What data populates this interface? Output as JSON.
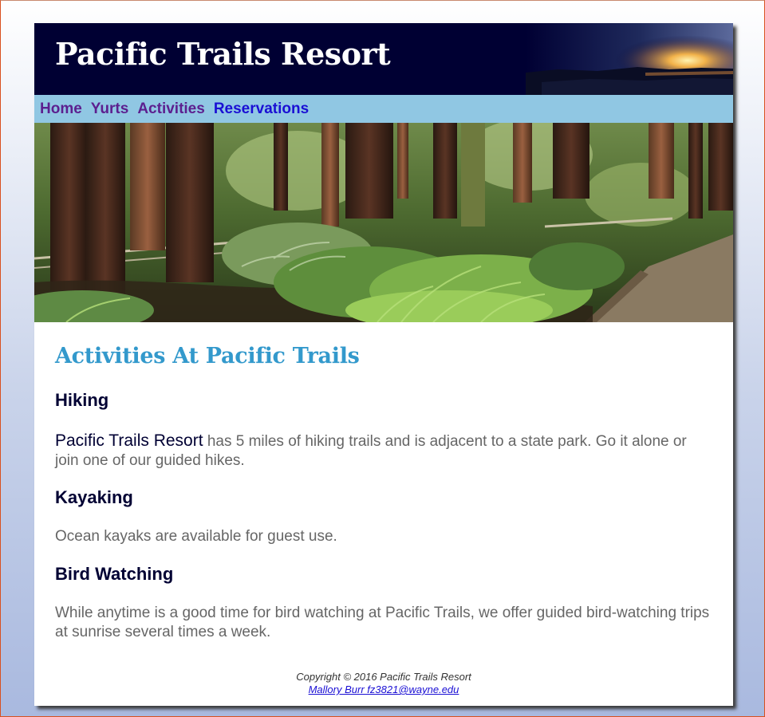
{
  "header": {
    "title": "Pacific Trails Resort"
  },
  "nav": {
    "items": [
      {
        "label": "Home",
        "state": "visited"
      },
      {
        "label": "Yurts",
        "state": "visited"
      },
      {
        "label": "Activities",
        "state": "visited"
      },
      {
        "label": "Reservations",
        "state": "unvisited"
      }
    ]
  },
  "hero": {
    "icon": "redwood-forest-image"
  },
  "main": {
    "heading": "Activities At Pacific Trails",
    "sections": [
      {
        "heading": "Hiking",
        "resort_name": "Pacific Trails Resort",
        "text": " has 5 miles of hiking trails and is adjacent to a state park. Go it alone or join one of our guided hikes."
      },
      {
        "heading": "Kayaking",
        "text": "Ocean kayaks are available for guest use."
      },
      {
        "heading": "Bird Watching",
        "text": "While anytime is a good time for bird watching at Pacific Trails, we offer guided bird-watching trips at sunrise several times a week."
      }
    ]
  },
  "footer": {
    "copyright": "Copyright © 2016 Pacific Trails Resort",
    "contact": "Mallory Burr fz3821@wayne.edu"
  },
  "colors": {
    "header_bg": "#000033",
    "nav_bg": "#90c7e3",
    "heading_accent": "#3399cc",
    "link_visited": "#5c1f8f",
    "link_unvisited": "#1a0fd4"
  }
}
